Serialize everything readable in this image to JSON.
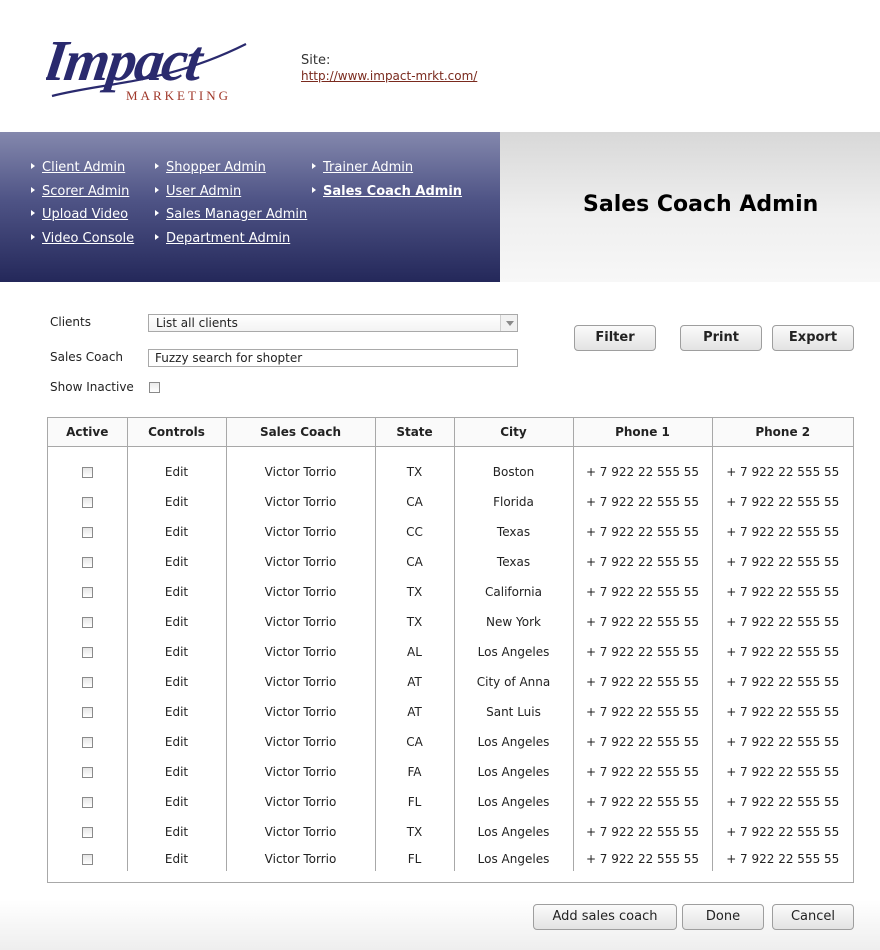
{
  "header": {
    "logo_text": "Impact",
    "logo_sub": "MARKETING",
    "site_label": "Site:",
    "site_url": "http://www.impact-mrkt.com/"
  },
  "nav": {
    "columns": [
      [
        "Client Admin",
        "Scorer Admin",
        "Upload Video",
        "Video Console"
      ],
      [
        "Shopper Admin",
        "User Admin",
        "Sales Manager Admin",
        "Department Admin"
      ],
      [
        "Trainer Admin",
        "Sales Coach Admin"
      ]
    ],
    "active": "Sales Coach Admin"
  },
  "page_title": "Sales Coach Admin",
  "filters": {
    "clients_label": "Clients",
    "clients_value": "List all clients",
    "coach_label": "Sales Coach",
    "coach_placeholder": "Fuzzy search for shopter",
    "inactive_label": "Show Inactive",
    "inactive_checked": false
  },
  "actions": {
    "filter": "Filter",
    "print": "Print",
    "export": "Export"
  },
  "table": {
    "columns": [
      "Active",
      "Controls",
      "Sales Coach",
      "State",
      "City",
      "Phone 1",
      "Phone 2"
    ],
    "rows": [
      {
        "control": "Edit",
        "coach": "Victor Torrio",
        "state": "TX",
        "city": "Boston",
        "phone1": "+ 7 922 22 555 55",
        "phone2": "+ 7 922 22 555 55"
      },
      {
        "control": "Edit",
        "coach": "Victor Torrio",
        "state": "CA",
        "city": "Florida",
        "phone1": "+ 7 922 22 555 55",
        "phone2": "+ 7 922 22 555 55"
      },
      {
        "control": "Edit",
        "coach": "Victor Torrio",
        "state": "CC",
        "city": "Texas",
        "phone1": "+ 7 922 22 555 55",
        "phone2": "+ 7 922 22 555 55"
      },
      {
        "control": "Edit",
        "coach": "Victor Torrio",
        "state": "CA",
        "city": "Texas",
        "phone1": "+ 7 922 22 555 55",
        "phone2": "+ 7 922 22 555 55"
      },
      {
        "control": "Edit",
        "coach": "Victor Torrio",
        "state": "TX",
        "city": "California",
        "phone1": "+ 7 922 22 555 55",
        "phone2": "+ 7 922 22 555 55"
      },
      {
        "control": "Edit",
        "coach": "Victor Torrio",
        "state": "TX",
        "city": "New York",
        "phone1": "+ 7 922 22 555 55",
        "phone2": "+ 7 922 22 555 55"
      },
      {
        "control": "Edit",
        "coach": "Victor Torrio",
        "state": "AL",
        "city": "Los Angeles",
        "phone1": "+ 7 922 22 555 55",
        "phone2": "+ 7 922 22 555 55"
      },
      {
        "control": "Edit",
        "coach": "Victor Torrio",
        "state": "AT",
        "city": "City of Anna",
        "phone1": "+ 7 922 22 555 55",
        "phone2": "+ 7 922 22 555 55"
      },
      {
        "control": "Edit",
        "coach": "Victor Torrio",
        "state": "AT",
        "city": "Sant Luis",
        "phone1": "+ 7 922 22 555 55",
        "phone2": "+ 7 922 22 555 55"
      },
      {
        "control": "Edit",
        "coach": "Victor Torrio",
        "state": "CA",
        "city": "Los Angeles",
        "phone1": "+ 7 922 22 555 55",
        "phone2": "+ 7 922 22 555 55"
      },
      {
        "control": "Edit",
        "coach": "Victor Torrio",
        "state": "FA",
        "city": "Los Angeles",
        "phone1": "+ 7 922 22 555 55",
        "phone2": "+ 7 922 22 555 55"
      },
      {
        "control": "Edit",
        "coach": "Victor Torrio",
        "state": "FL",
        "city": "Los Angeles",
        "phone1": "+ 7 922 22 555 55",
        "phone2": "+ 7 922 22 555 55"
      },
      {
        "control": "Edit",
        "coach": "Victor Torrio",
        "state": "TX",
        "city": "Los Angeles",
        "phone1": "+ 7 922 22 555 55",
        "phone2": "+ 7 922 22 555 55"
      },
      {
        "control": "Edit",
        "coach": "Victor Torrio",
        "state": "FL",
        "city": "Los Angeles",
        "phone1": "+ 7 922 22 555 55",
        "phone2": "+ 7 922 22 555 55"
      }
    ]
  },
  "footer": {
    "add": "Add sales coach",
    "done": "Done",
    "cancel": "Cancel"
  },
  "colors": {
    "nav_panel": "#2b2f66",
    "brand": "#2a2a6e",
    "brand_accent": "#a0382a",
    "link": "#7a2a1e"
  }
}
